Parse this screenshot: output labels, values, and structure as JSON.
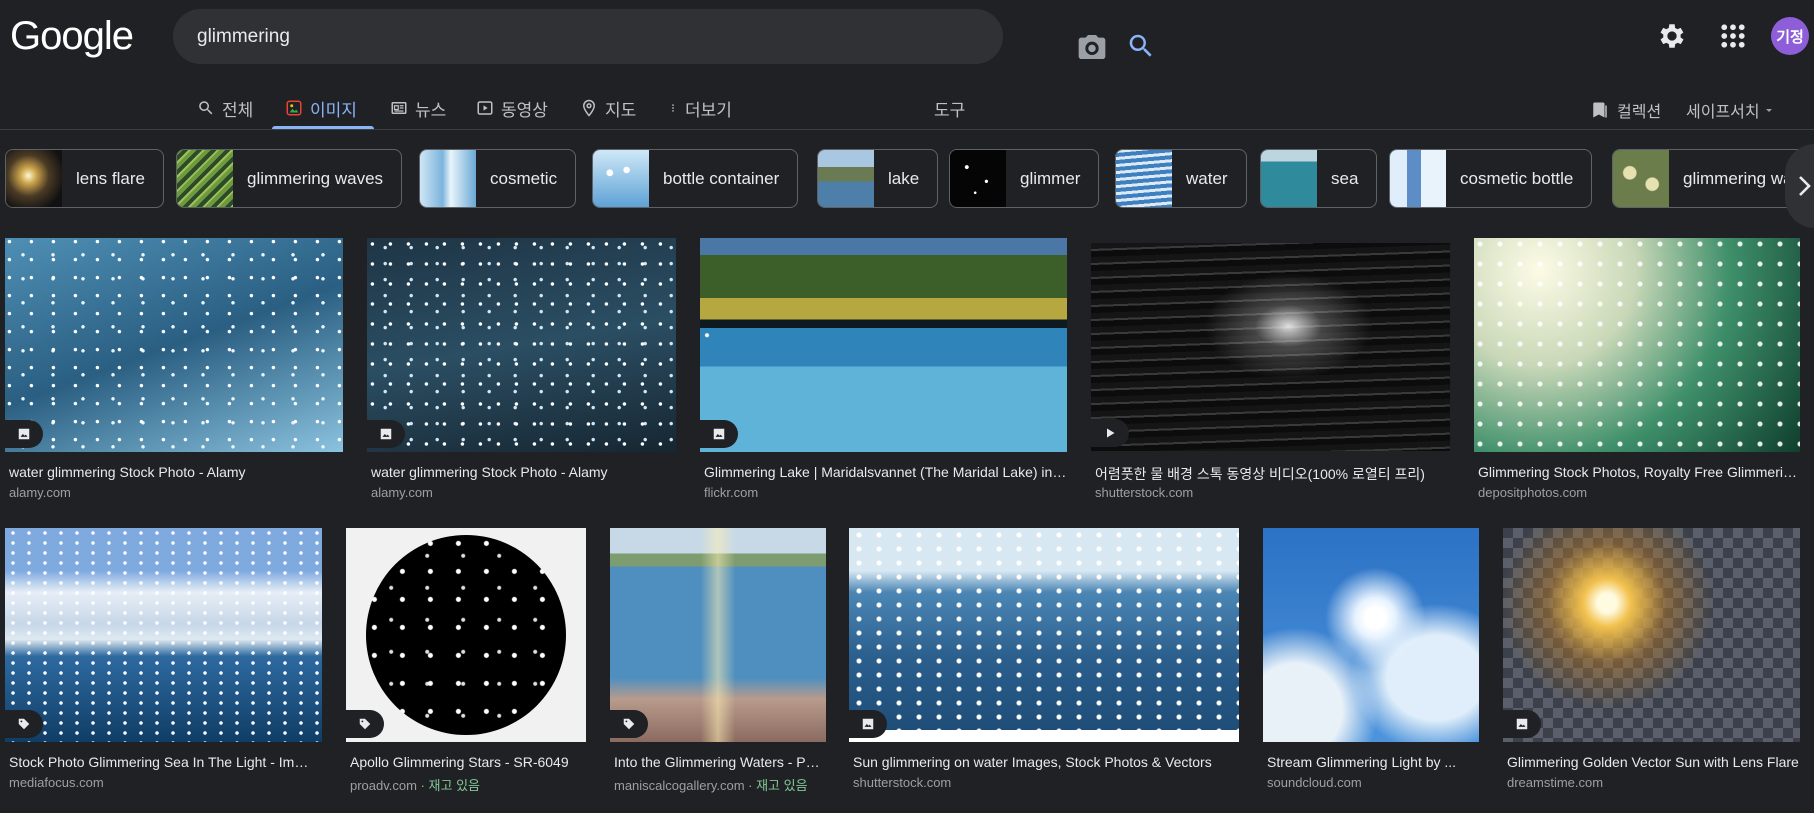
{
  "header": {
    "logo": "Google",
    "search_value": "glimmering",
    "avatar_text": "기정"
  },
  "nav": {
    "tabs": [
      {
        "label": "전체",
        "icon": "search-icon"
      },
      {
        "label": "이미지",
        "icon": "image-icon",
        "active": true
      },
      {
        "label": "뉴스",
        "icon": "news-icon"
      },
      {
        "label": "동영상",
        "icon": "video-icon"
      },
      {
        "label": "지도",
        "icon": "map-pin-icon"
      },
      {
        "label": "더보기",
        "icon": "more-vert-icon"
      }
    ],
    "tools": "도구",
    "collections": "컬렉션",
    "safesearch": "세이프서치"
  },
  "chips": [
    {
      "label": "lens flare"
    },
    {
      "label": "glimmering waves"
    },
    {
      "label": "cosmetic"
    },
    {
      "label": "bottle container"
    },
    {
      "label": "lake"
    },
    {
      "label": "glimmer"
    },
    {
      "label": "water"
    },
    {
      "label": "sea"
    },
    {
      "label": "cosmetic bottle"
    },
    {
      "label": "glimmering water"
    }
  ],
  "results": [
    {
      "title": "water glimmering Stock Photo - Alamy",
      "source": "alamy.com",
      "badge": "image-icon"
    },
    {
      "title": "water glimmering Stock Photo - Alamy",
      "source": "alamy.com",
      "badge": "image-icon"
    },
    {
      "title": "Glimmering Lake | Maridalsvannet (The Maridal Lake) in Oslo",
      "source": "flickr.com",
      "badge": "image-icon"
    },
    {
      "title": "어렴풋한 물 배경 스톡 동영상 비디오(100% 로열티 프리)",
      "source": "shutterstock.com",
      "badge": "play-icon"
    },
    {
      "title": "Glimmering Stock Photos, Royalty Free Glimmering Images",
      "source": "depositphotos.com",
      "badge": ""
    },
    {
      "title": "Stock Photo Glimmering Sea In The Light - Image",
      "source": "mediafocus.com",
      "badge": "tag-icon"
    },
    {
      "title": "Apollo Glimmering Stars - SR-6049",
      "source": "proadv.com",
      "stock": "· 재고 있음",
      "badge": "tag-icon"
    },
    {
      "title": "Into the Glimmering Waters - Painting",
      "source": "maniscalcogallery.com",
      "stock": "· 재고 있음",
      "badge": "tag-icon"
    },
    {
      "title": "Sun glimmering on water Images, Stock Photos & Vectors",
      "source": "shutterstock.com",
      "badge": "image-icon"
    },
    {
      "title": "Stream Glimmering Light by ...",
      "source": "soundcloud.com",
      "badge": ""
    },
    {
      "title": "Glimmering Golden Vector Sun with Lens Flare",
      "source": "dreamstime.com",
      "badge": "image-icon"
    }
  ],
  "colors": {
    "background": "#202124",
    "accent": "#8ab4f8",
    "avatar": "#8e5ed8",
    "stock_green": "#81c995"
  }
}
